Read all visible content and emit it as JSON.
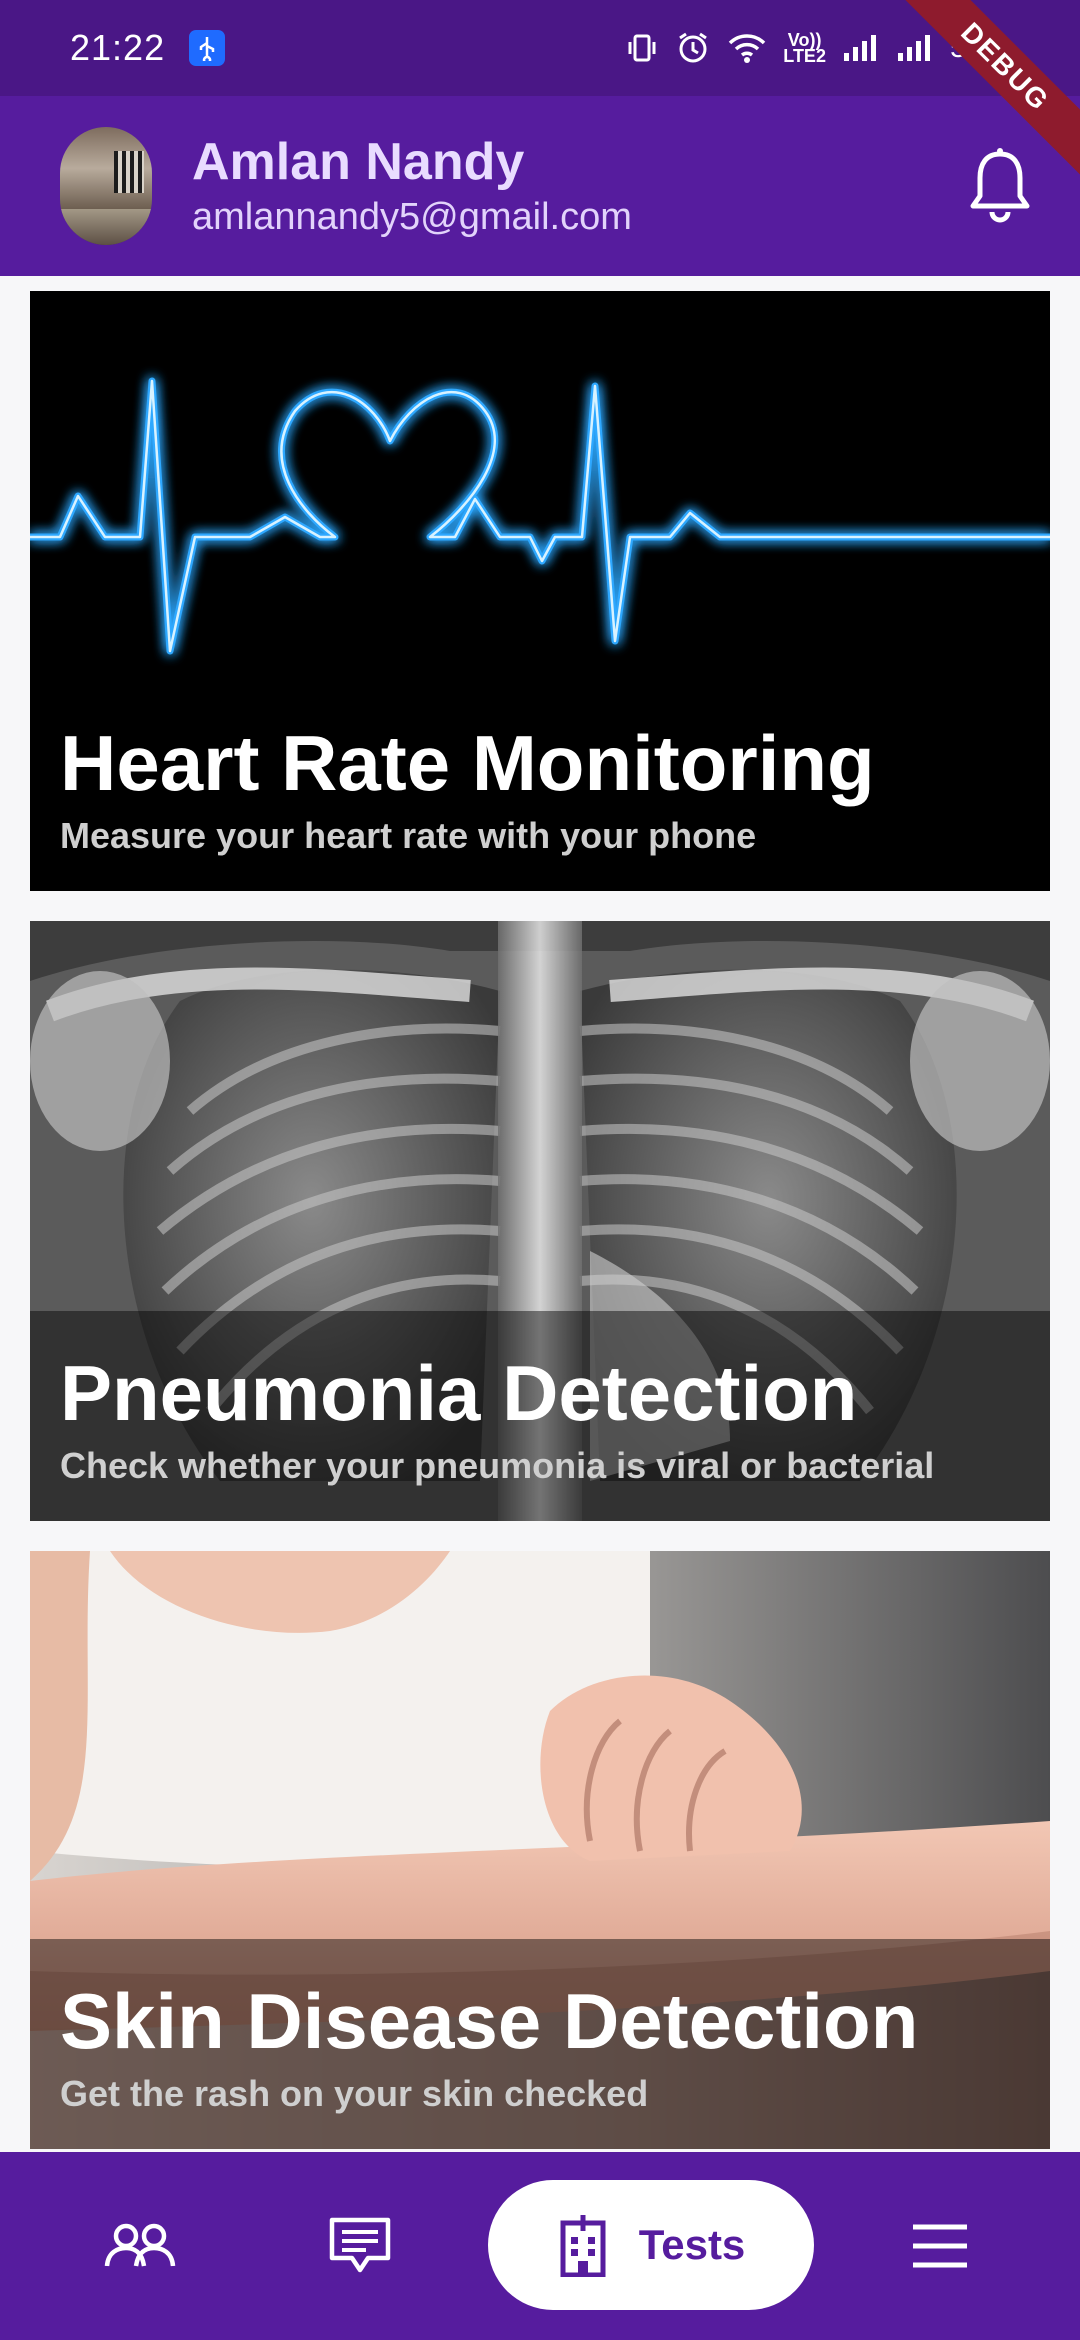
{
  "status_bar": {
    "time": "21:22",
    "volte_line1": "Vo))",
    "volte_line2": "LTE2",
    "battery": "55%",
    "icons": [
      "usb-icon",
      "vibrate-icon",
      "alarm-icon",
      "wifi-icon",
      "volte-icon",
      "signal-icon",
      "signal-icon",
      "battery-icon"
    ]
  },
  "debug_ribbon": "DEBUG",
  "header": {
    "name": "Amlan Nandy",
    "email": "amlannandy5@gmail.com",
    "avatar": "profile-photo",
    "action_icon": "bell-icon"
  },
  "cards": [
    {
      "title": "Heart Rate Monitoring",
      "subtitle": "Measure your heart rate with your phone",
      "image": "heartbeat-line-image"
    },
    {
      "title": "Pneumonia Detection",
      "subtitle": "Check whether your pneumonia is viral or bacterial",
      "image": "chest-xray-image"
    },
    {
      "title": "Skin Disease Detection",
      "subtitle": "Get the rash on your skin checked",
      "image": "skin-rash-image"
    }
  ],
  "bottom_nav": {
    "items": [
      {
        "icon": "people-icon",
        "label": ""
      },
      {
        "icon": "chat-icon",
        "label": ""
      },
      {
        "icon": "hospital-icon",
        "label": "Tests",
        "active": true
      },
      {
        "icon": "menu-icon",
        "label": ""
      }
    ]
  },
  "colors": {
    "primary": "#561c9e",
    "status_bar": "#4a1786",
    "glow_blue": "#2fa8ff",
    "debug": "#8e1b2d"
  }
}
